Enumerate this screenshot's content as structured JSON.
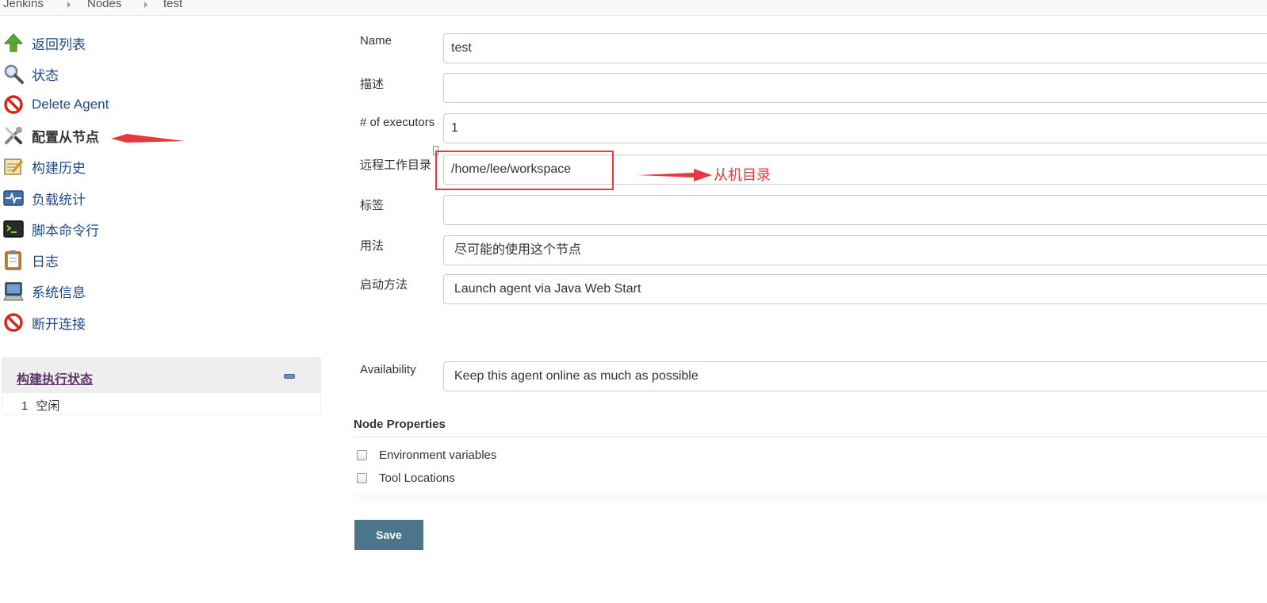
{
  "breadcrumb": {
    "items": [
      "Jenkins",
      "Nodes",
      "test"
    ]
  },
  "sidebar": {
    "items": [
      {
        "label": "返回列表",
        "icon": "up-arrow-icon"
      },
      {
        "label": "状态",
        "icon": "magnifier-icon"
      },
      {
        "label": "Delete Agent",
        "icon": "no-entry-icon"
      },
      {
        "label": "配置从节点",
        "icon": "wrench-screwdriver-icon",
        "active": true
      },
      {
        "label": "构建历史",
        "icon": "notepad-icon"
      },
      {
        "label": "负载统计",
        "icon": "monitor-graph-icon"
      },
      {
        "label": "脚本命令行",
        "icon": "terminal-icon"
      },
      {
        "label": "日志",
        "icon": "clipboard-icon"
      },
      {
        "label": "系统信息",
        "icon": "computer-icon"
      },
      {
        "label": "断开连接",
        "icon": "no-entry-icon"
      }
    ]
  },
  "executor_panel": {
    "title": "构建执行状态",
    "rows": [
      {
        "number": "1",
        "status": "空闲"
      }
    ]
  },
  "form": {
    "name_label": "Name",
    "name_value": "test",
    "description_label": "描述",
    "description_value": "",
    "executors_label": "# of executors",
    "executors_value": "1",
    "remote_dir_label": "远程工作目录",
    "remote_dir_value": "/home/lee/workspace",
    "labels_label": "标签",
    "labels_value": "",
    "usage_label": "用法",
    "usage_value": "尽可能的使用这个节点",
    "launch_label": "启动方法",
    "launch_value": "Launch agent via Java Web Start",
    "availability_label": "Availability",
    "availability_value": "Keep this agent online as much as possible"
  },
  "node_properties": {
    "title": "Node Properties",
    "options": [
      {
        "label": "Environment variables",
        "checked": false
      },
      {
        "label": "Tool Locations",
        "checked": false
      }
    ]
  },
  "save_label": "Save",
  "annotation": {
    "text": "从机目录",
    "color": "#e8383d"
  },
  "colors": {
    "link": "#204a87",
    "save_button": "#4b758b",
    "annotation_red": "#e8383d"
  }
}
